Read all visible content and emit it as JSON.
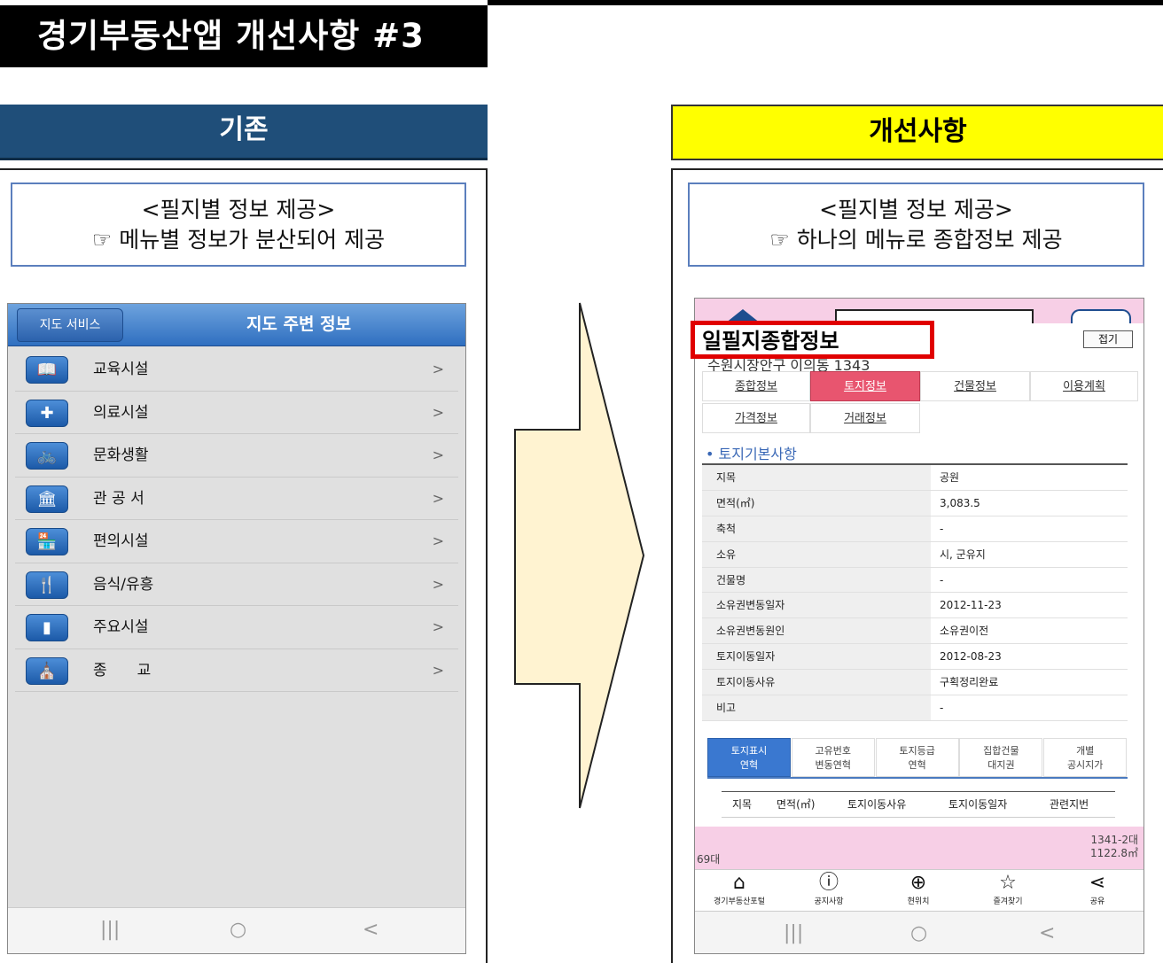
{
  "title": "경기부동산앱 개선사항 #3",
  "left": {
    "header": "기존",
    "note_line1": "<필지별 정보 제공>",
    "note_line2": "☞ 메뉴별 정보가 분산되어 제공",
    "app": {
      "back_label": "지도 서비스",
      "title": "지도 주변 정보",
      "items": [
        {
          "label": "교육시설",
          "icon": "book-icon",
          "glyph": "📖"
        },
        {
          "label": "의료시설",
          "icon": "medical-cross-icon",
          "glyph": "✚"
        },
        {
          "label": "문화생활",
          "icon": "bicycle-icon",
          "glyph": "🚲"
        },
        {
          "label": "관 공 서",
          "icon": "government-building-icon",
          "glyph": "🏛"
        },
        {
          "label": "편의시설",
          "icon": "convenience-store-icon",
          "glyph": "🏪"
        },
        {
          "label": "음식/유흥",
          "icon": "fork-glass-icon",
          "glyph": "🍴"
        },
        {
          "label": "주요시설",
          "icon": "building-icon",
          "glyph": "▮"
        },
        {
          "label": "종　　교",
          "icon": "religion-icon",
          "glyph": "⛪"
        }
      ],
      "arrow": ">"
    }
  },
  "right": {
    "header": "개선사항",
    "note_line1": "<필지별 정보 제공>",
    "note_line2": "☞ 하나의 메뉴로 종합정보 제공",
    "app": {
      "highlight_label": "일필지종합정보",
      "fold_label": "접기",
      "address": "수원시장안구 이의동 1343",
      "tabs": [
        "종합정보",
        "토지정보",
        "건물정보",
        "이용계획",
        "가격정보",
        "거래정보"
      ],
      "active_tab": "토지정보",
      "section_title": "• 토지기본사항",
      "rows": [
        {
          "k": "지목",
          "v": "공원"
        },
        {
          "k": "면적(㎡)",
          "v": "3,083.5"
        },
        {
          "k": "축척",
          "v": "-"
        },
        {
          "k": "소유",
          "v": "시, 군유지"
        },
        {
          "k": "건물명",
          "v": "-"
        },
        {
          "k": "소유권변동일자",
          "v": "2012-11-23"
        },
        {
          "k": "소유권변동원인",
          "v": "소유권이전"
        },
        {
          "k": "토지이동일자",
          "v": "2012-08-23"
        },
        {
          "k": "토지이동사유",
          "v": "구획정리완료"
        },
        {
          "k": "비고",
          "v": "-"
        }
      ],
      "subtabs": [
        {
          "l1": "토지표시",
          "l2": "연혁"
        },
        {
          "l1": "고유번호",
          "l2": "변동연혁"
        },
        {
          "l1": "토지등급",
          "l2": "연혁"
        },
        {
          "l1": "집합건물",
          "l2": "대지권"
        },
        {
          "l1": "개별",
          "l2": "공시지가"
        }
      ],
      "subhead": [
        "지목",
        "면적(㎡)",
        "토지이동사유",
        "토지이동일자",
        "관련지번"
      ],
      "map_label1": "1341-2대",
      "map_label2": "1122.8㎡",
      "map_left": "69대",
      "tabbar": [
        {
          "label": "경기부동산포털",
          "icon": "home-icon",
          "glyph": "⌂"
        },
        {
          "label": "공지사항",
          "icon": "notice-icon",
          "glyph": "ⓘ"
        },
        {
          "label": "현위치",
          "icon": "location-icon",
          "glyph": "⊕"
        },
        {
          "label": "즐겨찾기",
          "icon": "star-icon",
          "glyph": "☆"
        },
        {
          "label": "공유",
          "icon": "share-icon",
          "glyph": "⋖"
        }
      ]
    }
  },
  "nav": {
    "recent": "|||",
    "home": "○",
    "back": "<"
  }
}
